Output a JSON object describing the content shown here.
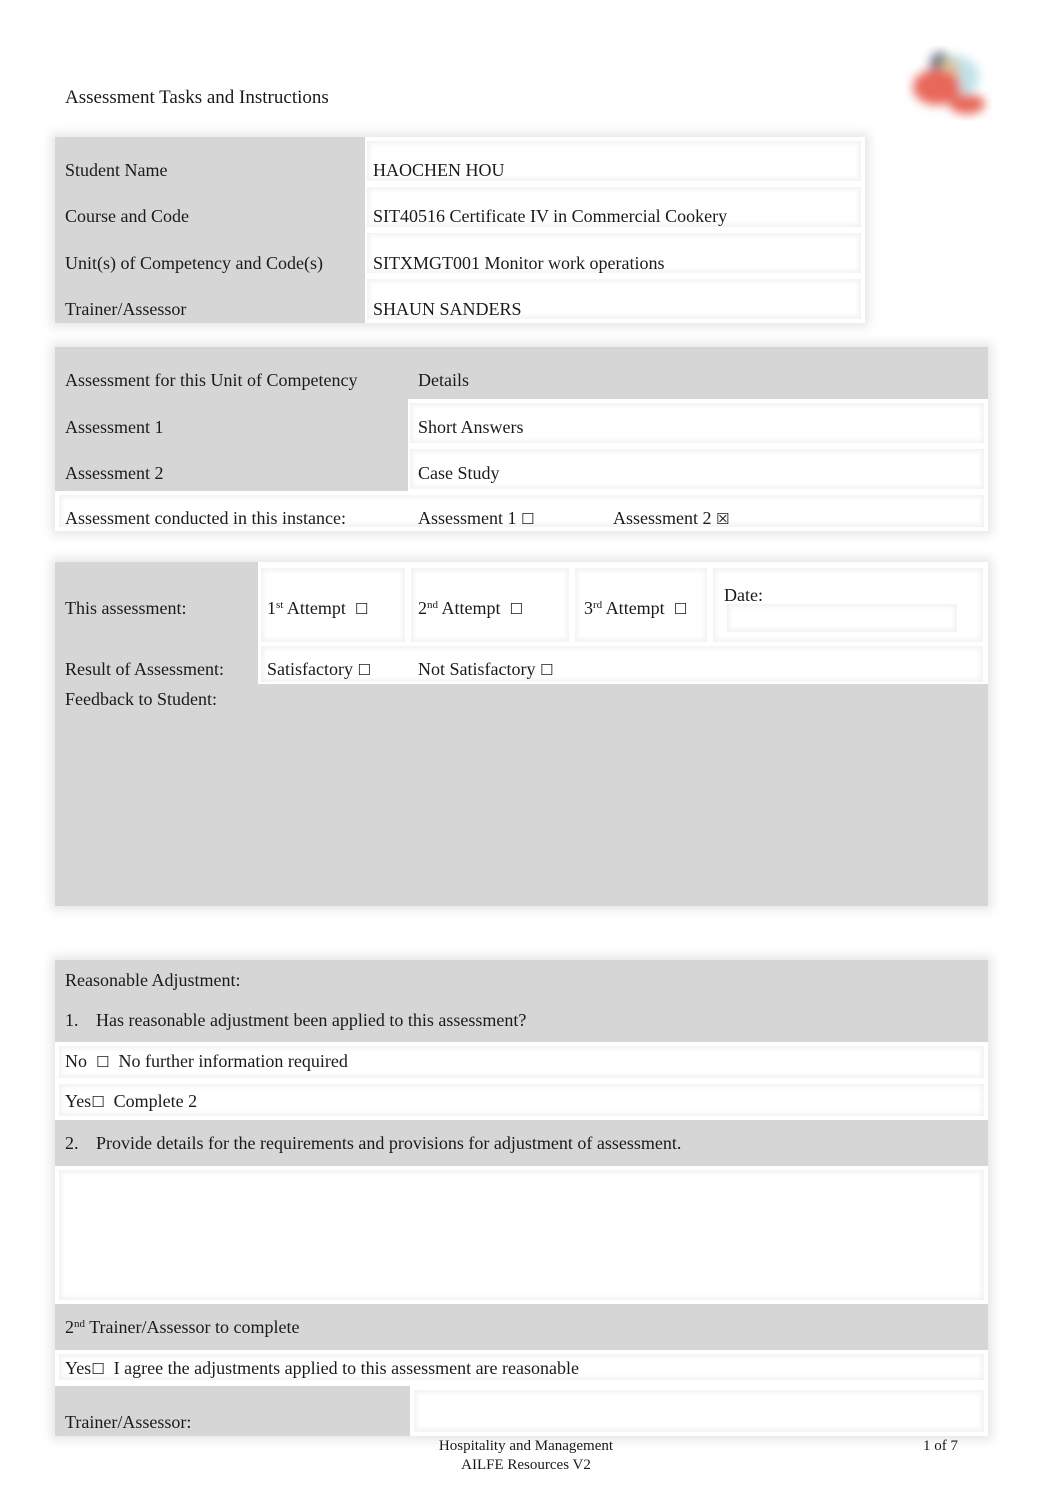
{
  "header": {
    "title": "Assessment Tasks and Instructions",
    "logo": "organisation-logo"
  },
  "student_info": {
    "rows": [
      {
        "label": "Student Name",
        "value": "HAOCHEN HOU"
      },
      {
        "label": "Course and Code",
        "value": "SIT40516 Certificate IV in Commercial Cookery"
      },
      {
        "label": "Unit(s) of Competency and Code(s)",
        "value": "SITXMGT001 Monitor work operations"
      },
      {
        "label": "Trainer/Assessor",
        "value": "SHAUN SANDERS"
      }
    ]
  },
  "assessment_table": {
    "header_left": "Assessment for this Unit of Competency",
    "header_right": "Details",
    "rows": [
      {
        "label": "Assessment 1",
        "value": "Short Answers"
      },
      {
        "label": "Assessment 2",
        "value": "Case Study"
      }
    ],
    "conducted_label": "Assessment conducted in this instance:",
    "conducted_options": [
      {
        "label": "Assessment 1",
        "checked": false,
        "box": "☐"
      },
      {
        "label": "Assessment 2",
        "checked": true,
        "box": "☒"
      }
    ]
  },
  "attempt": {
    "label": "This assessment:",
    "options": [
      {
        "num": "1",
        "sup": "st",
        "text": "Attempt",
        "checked": false,
        "box": "☐"
      },
      {
        "num": "2",
        "sup": "nd",
        "text": "Attempt",
        "checked": false,
        "box": "☐"
      },
      {
        "num": "3",
        "sup": "rd",
        "text": "Attempt",
        "checked": false,
        "box": "☐"
      }
    ],
    "date_label": "Date:",
    "date_value": ""
  },
  "result": {
    "label": "Result of Assessment:",
    "options": [
      {
        "label": "Satisfactory",
        "checked": false,
        "box": "☐"
      },
      {
        "label": "Not Satisfactory",
        "checked": false,
        "box": "☐"
      }
    ],
    "feedback_label": "Feedback to Student:",
    "feedback_value": ""
  },
  "reasonable_adjustment": {
    "heading": "Reasonable Adjustment:",
    "q1_num": "1.",
    "q1_text": "Has reasonable adjustment been applied to this assessment?",
    "no_label": "No",
    "no_box": "☐",
    "no_text": "No further information required",
    "yes_label": "Yes",
    "yes_box": "☐",
    "yes_text": "Complete 2",
    "q2_num": "2.",
    "q2_text": "Provide details for the requirements and provisions for adjustment of assessment.",
    "details_value": "",
    "second_assessor_num": "2",
    "second_assessor_sup": "nd",
    "second_assessor_text": "Trainer/Assessor to complete",
    "agree_label": "Yes",
    "agree_box": "☐",
    "agree_text": "I agree the adjustments applied to this assessment are reasonable",
    "trainer_label": "Trainer/Assessor:",
    "trainer_value": ""
  },
  "footer": {
    "line1": "Hospitality and Management",
    "line2": "AILFE Resources V2",
    "page": "1 of 7"
  }
}
